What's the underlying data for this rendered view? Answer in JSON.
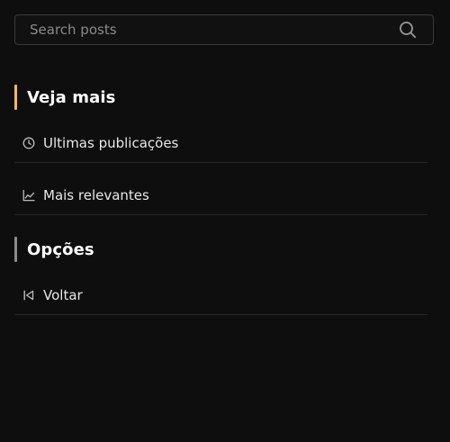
{
  "search": {
    "placeholder": "Search posts",
    "value": ""
  },
  "sections": [
    {
      "title": "Veja mais",
      "accent": "#f4b85a",
      "items": [
        {
          "label": "Ultimas publicações",
          "icon": "clock-icon"
        },
        {
          "label": "Mais relevantes",
          "icon": "trending-chart-icon"
        }
      ]
    },
    {
      "title": "Opções",
      "accent": "#8c8c8c",
      "items": [
        {
          "label": "Voltar",
          "icon": "skip-back-icon"
        }
      ]
    }
  ],
  "colors": {
    "background": "#0e0e0e",
    "divider": "#262626",
    "border": "#3a3a3a",
    "text": "#e8e8e8",
    "muted": "#8a8a8a"
  }
}
